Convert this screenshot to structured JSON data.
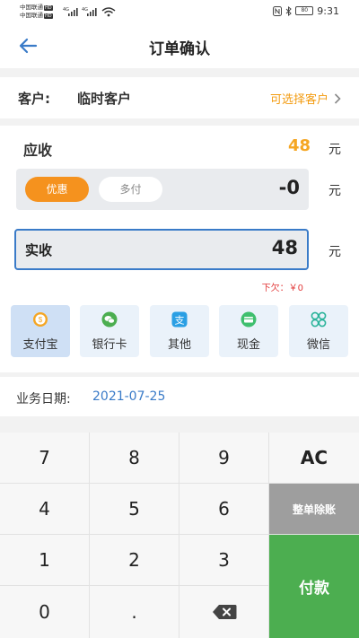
{
  "status_bar": {
    "carrier1": "中国联通",
    "carrier2": "中国联通",
    "hd": "HD",
    "net1": "4G",
    "net2": "4G",
    "battery": "80",
    "time": "9:31"
  },
  "header": {
    "title": "订单确认"
  },
  "customer": {
    "label": "客户:",
    "name": "临时客户",
    "select_label": "可选择客户"
  },
  "amounts": {
    "receivable_label": "应收",
    "receivable_value": "48",
    "unit": "元",
    "discount_tab": "优惠",
    "overpay_tab": "多付",
    "discount_value": "-0",
    "actual_label": "实收",
    "actual_value": "48",
    "owed_text": "下欠：￥0"
  },
  "payment_methods": [
    {
      "label": "支付宝",
      "icon": "alipay-icon",
      "selected": true
    },
    {
      "label": "银行卡",
      "icon": "wechat-chat-icon",
      "selected": false
    },
    {
      "label": "其他",
      "icon": "alipay-other-icon",
      "selected": false
    },
    {
      "label": "现金",
      "icon": "cash-icon",
      "selected": false
    },
    {
      "label": "微信",
      "icon": "clover-icon",
      "selected": false
    }
  ],
  "business_date": {
    "label": "业务日期:",
    "value": "2021-07-25"
  },
  "keypad": {
    "k7": "7",
    "k8": "8",
    "k9": "9",
    "ac": "AC",
    "k4": "4",
    "k5": "5",
    "k6": "6",
    "clear_order": "整单除账",
    "k1": "1",
    "k2": "2",
    "k3": "3",
    "pay": "付款",
    "k0": "0",
    "dot": ".",
    "backspace_icon": "backspace-icon"
  },
  "colors": {
    "accent_blue": "#3a7bc8",
    "orange": "#f5921e",
    "amount_orange": "#f5a623",
    "pay_green": "#4cae50",
    "clear_gray": "#9e9e9e",
    "owed_red": "#e23b3b"
  }
}
